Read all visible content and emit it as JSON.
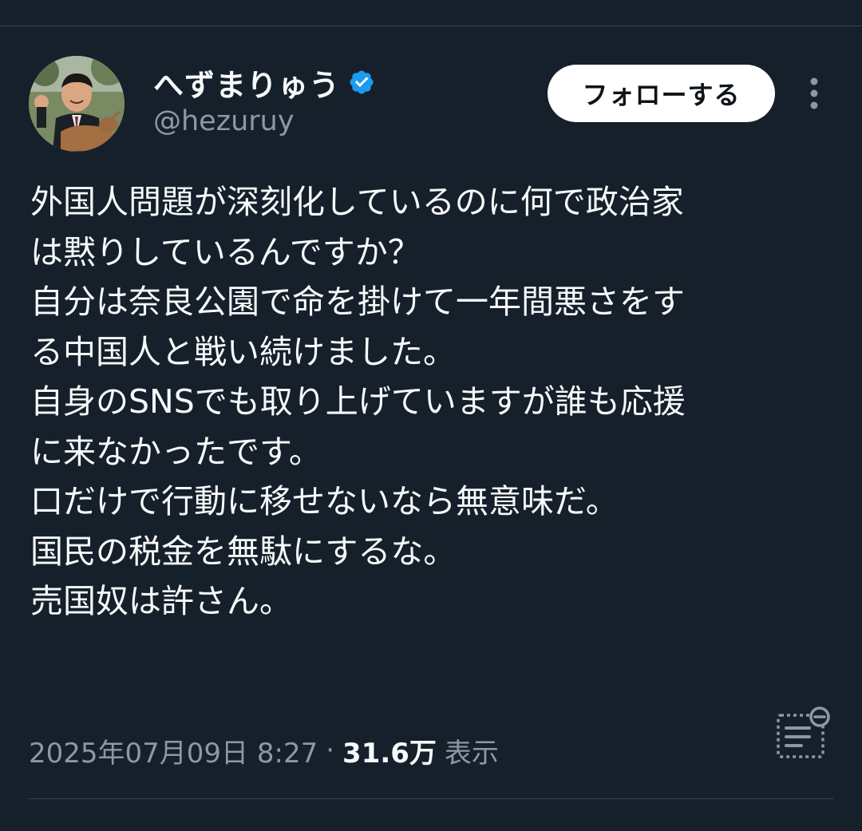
{
  "user": {
    "display_name": "へずまりゅう",
    "handle": "@hezuruy",
    "verified": true
  },
  "follow_button_label": "フォローする",
  "tweet": {
    "lines": [
      "外国人問題が深刻化しているのに何で政治家",
      "は黙りしているんですか？",
      "自分は奈良公園で命を掛けて一年間悪さをす",
      "る中国人と戦い続けました。",
      "自身のSNSでも取り上げていますが誰も応援",
      "に来なかったです。",
      "口だけで行動に移せないなら無意味だ。",
      "国民の税金を無駄にするな。",
      "売国奴は許さん。"
    ]
  },
  "meta": {
    "timestamp": "2025年07月09日 8:27",
    "separator": "·",
    "views": "31.6万",
    "views_label": "表示"
  },
  "icons": {
    "verified": "verified-badge-icon",
    "more": "more-vertical-icon",
    "summary": "post-summary-icon"
  },
  "colors": {
    "background": "#15202b",
    "verified": "#1d9bf0",
    "secondary_text": "#8b98a5",
    "primary_text": "#f7f9f9"
  }
}
